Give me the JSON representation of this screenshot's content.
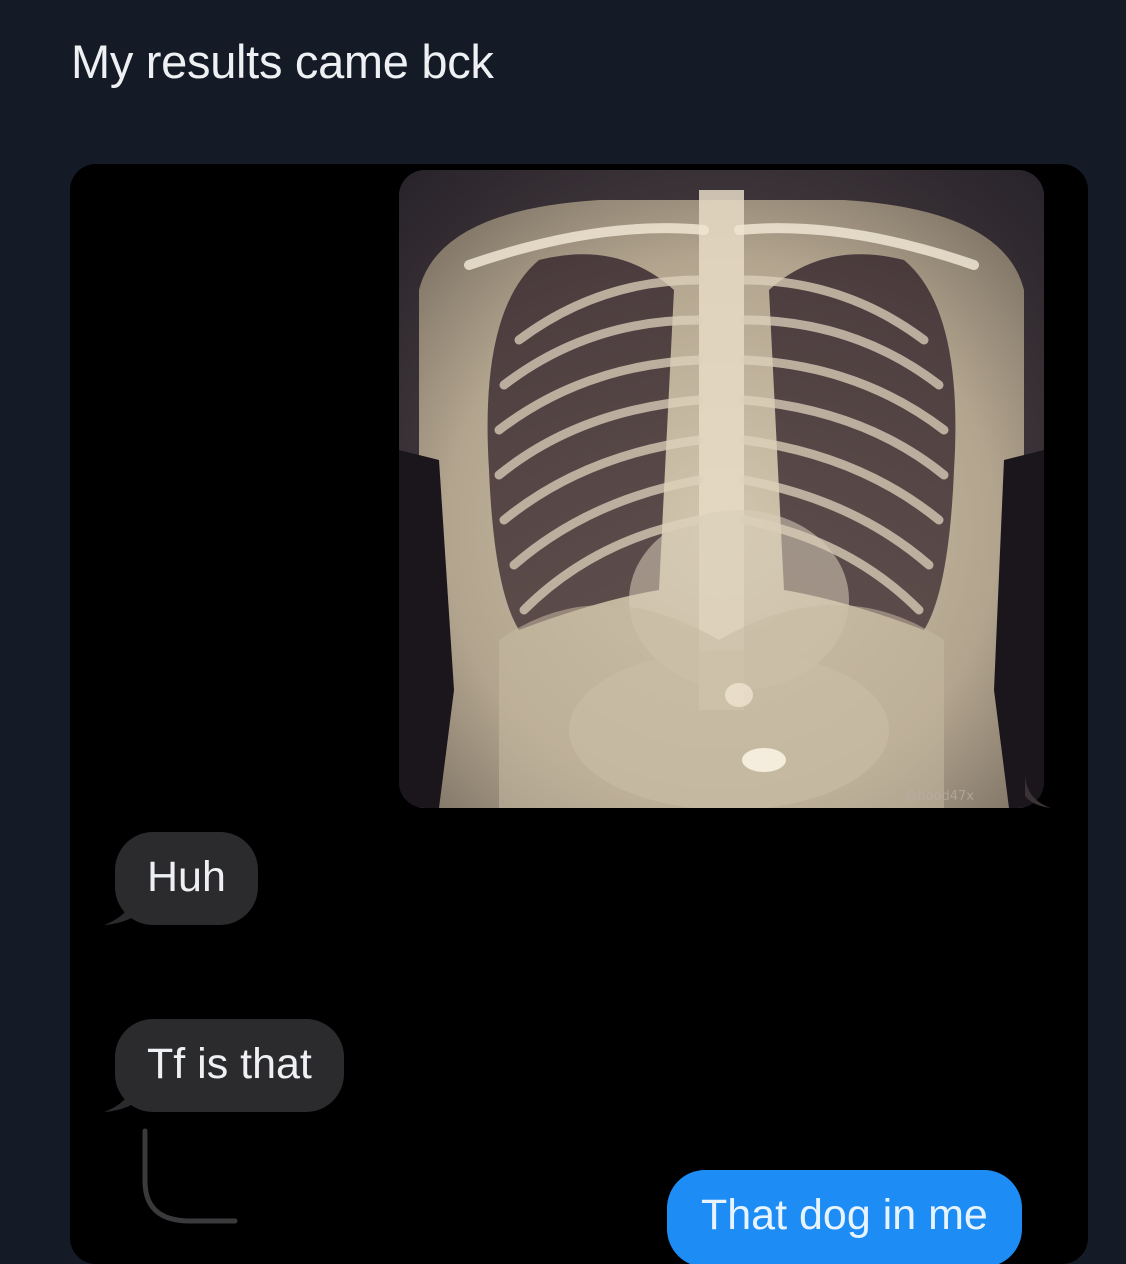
{
  "post": {
    "text": "My results came bck"
  },
  "conversation": {
    "image_message": {
      "description": "x-ray-image",
      "watermark": "@hood47x"
    },
    "messages": [
      {
        "direction": "incoming",
        "text": "Huh"
      },
      {
        "direction": "incoming",
        "text": "Tf is that"
      },
      {
        "direction": "outgoing",
        "text": "That dog in me"
      }
    ]
  },
  "colors": {
    "page_background": "#141b26",
    "chat_background": "#000000",
    "incoming_bubble": "#2b2b2d",
    "outgoing_bubble": "#1d8df5",
    "text_light": "#eef0f3"
  }
}
